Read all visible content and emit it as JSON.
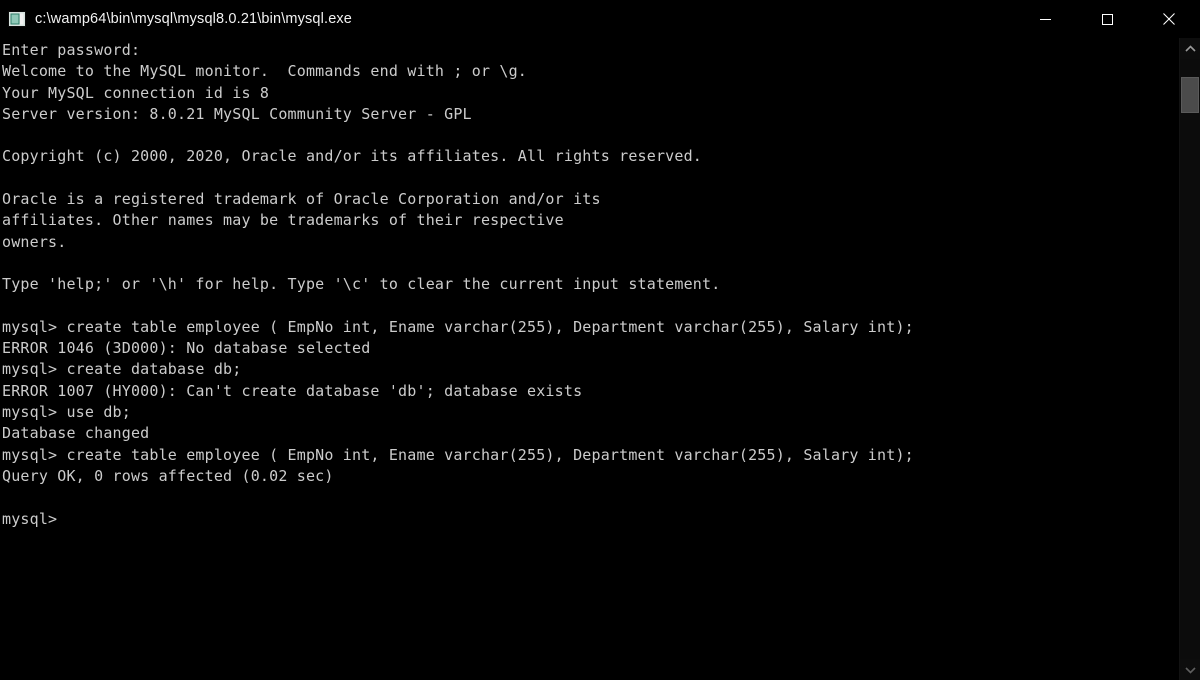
{
  "window": {
    "title": "c:\\wamp64\\bin\\mysql\\mysql8.0.21\\bin\\mysql.exe",
    "icon": "console-app-icon",
    "background_color": "#000000",
    "text_color": "#cccccc"
  },
  "titlebar": {
    "minimize_label": "–",
    "maximize_label": "□",
    "close_label": "✕"
  },
  "scrollbar": {
    "up_arrow": "∧",
    "down_arrow": "∨",
    "thumb_position_percent": 3,
    "thumb_size_percent": 6
  },
  "terminal": {
    "prompt": "mysql>",
    "lines": [
      "Enter password:",
      "Welcome to the MySQL monitor.  Commands end with ; or \\g.",
      "Your MySQL connection id is 8",
      "Server version: 8.0.21 MySQL Community Server - GPL",
      "",
      "Copyright (c) 2000, 2020, Oracle and/or its affiliates. All rights reserved.",
      "",
      "Oracle is a registered trademark of Oracle Corporation and/or its",
      "affiliates. Other names may be trademarks of their respective",
      "owners.",
      "",
      "Type 'help;' or '\\h' for help. Type '\\c' to clear the current input statement.",
      "",
      "mysql> create table employee ( EmpNo int, Ename varchar(255), Department varchar(255), Salary int);",
      "ERROR 1046 (3D000): No database selected",
      "mysql> create database db;",
      "ERROR 1007 (HY000): Can't create database 'db'; database exists",
      "mysql> use db;",
      "Database changed",
      "mysql> create table employee ( EmpNo int, Ename varchar(255), Department varchar(255), Salary int);",
      "Query OK, 0 rows affected (0.02 sec)",
      "",
      "mysql>"
    ]
  }
}
